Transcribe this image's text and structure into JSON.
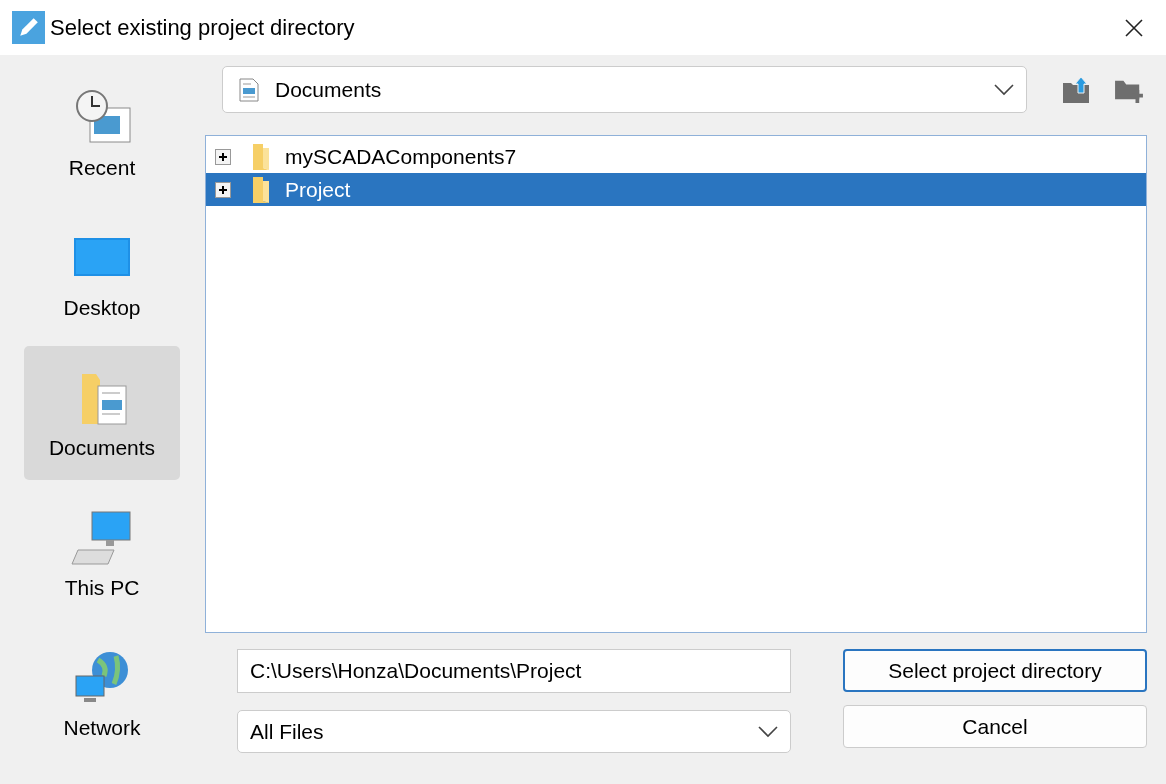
{
  "window": {
    "title": "Select existing project directory"
  },
  "sidebar": {
    "items": [
      {
        "label": "Recent",
        "kind": "recent",
        "selected": false
      },
      {
        "label": "Desktop",
        "kind": "desktop",
        "selected": false
      },
      {
        "label": "Documents",
        "kind": "documents",
        "selected": true
      },
      {
        "label": "This PC",
        "kind": "pc",
        "selected": false
      },
      {
        "label": "Network",
        "kind": "network",
        "selected": false
      }
    ]
  },
  "location": {
    "value": "Documents"
  },
  "tree": {
    "items": [
      {
        "label": "mySCADAComponents7",
        "expanded": false,
        "selected": false
      },
      {
        "label": "Project",
        "expanded": false,
        "selected": true
      }
    ]
  },
  "path_field": {
    "value": "C:\\Users\\Honza\\Documents\\Project"
  },
  "filter": {
    "value": "All Files"
  },
  "buttons": [
    {
      "label": "Select project directory",
      "kind": "primary"
    },
    {
      "label": "Cancel",
      "kind": "secondary"
    }
  ]
}
